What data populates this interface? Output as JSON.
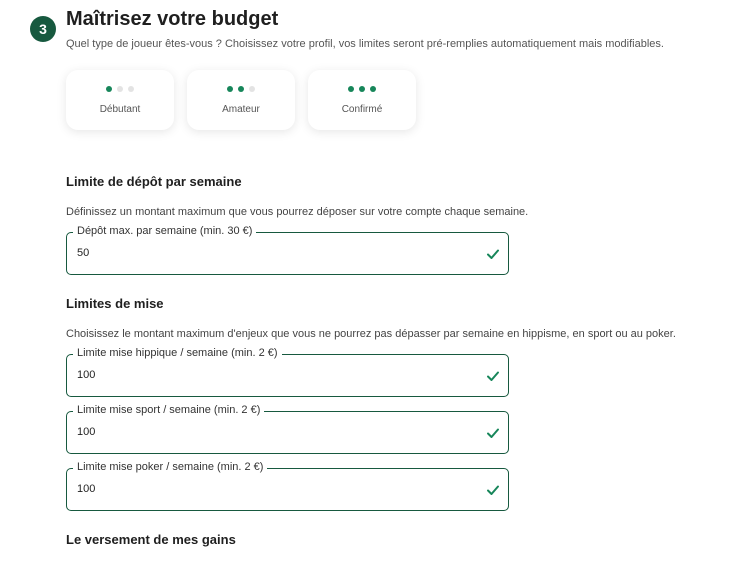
{
  "header": {
    "step_number": "3",
    "title": "Maîtrisez votre budget",
    "subtitle": "Quel type de joueur êtes-vous ? Choisissez votre profil, vos limites seront pré-remplies automatiquement mais modifiables."
  },
  "profiles": [
    {
      "label": "Débutant",
      "level": 1
    },
    {
      "label": "Amateur",
      "level": 2
    },
    {
      "label": "Confirmé",
      "level": 3
    }
  ],
  "deposit": {
    "title": "Limite de dépôt par semaine",
    "description": "Définissez un montant maximum que vous pourrez déposer sur votre compte chaque semaine.",
    "field_label": "Dépôt max. par semaine (min. 30 €)",
    "value": "50"
  },
  "bets": {
    "title": "Limites de mise",
    "description": "Choisissez le montant maximum d'enjeux que vous ne pourrez pas dépasser par semaine en hippisme, en sport ou au poker.",
    "horse": {
      "field_label": "Limite mise hippique / semaine (min. 2 €)",
      "value": "100"
    },
    "sport": {
      "field_label": "Limite mise sport / semaine (min. 2 €)",
      "value": "100"
    },
    "poker": {
      "field_label": "Limite mise poker / semaine (min. 2 €)",
      "value": "100"
    }
  },
  "winnings": {
    "title": "Le versement de mes gains"
  },
  "colors": {
    "accent": "#17593f",
    "dot_active": "#17865a",
    "check": "#17865a"
  }
}
